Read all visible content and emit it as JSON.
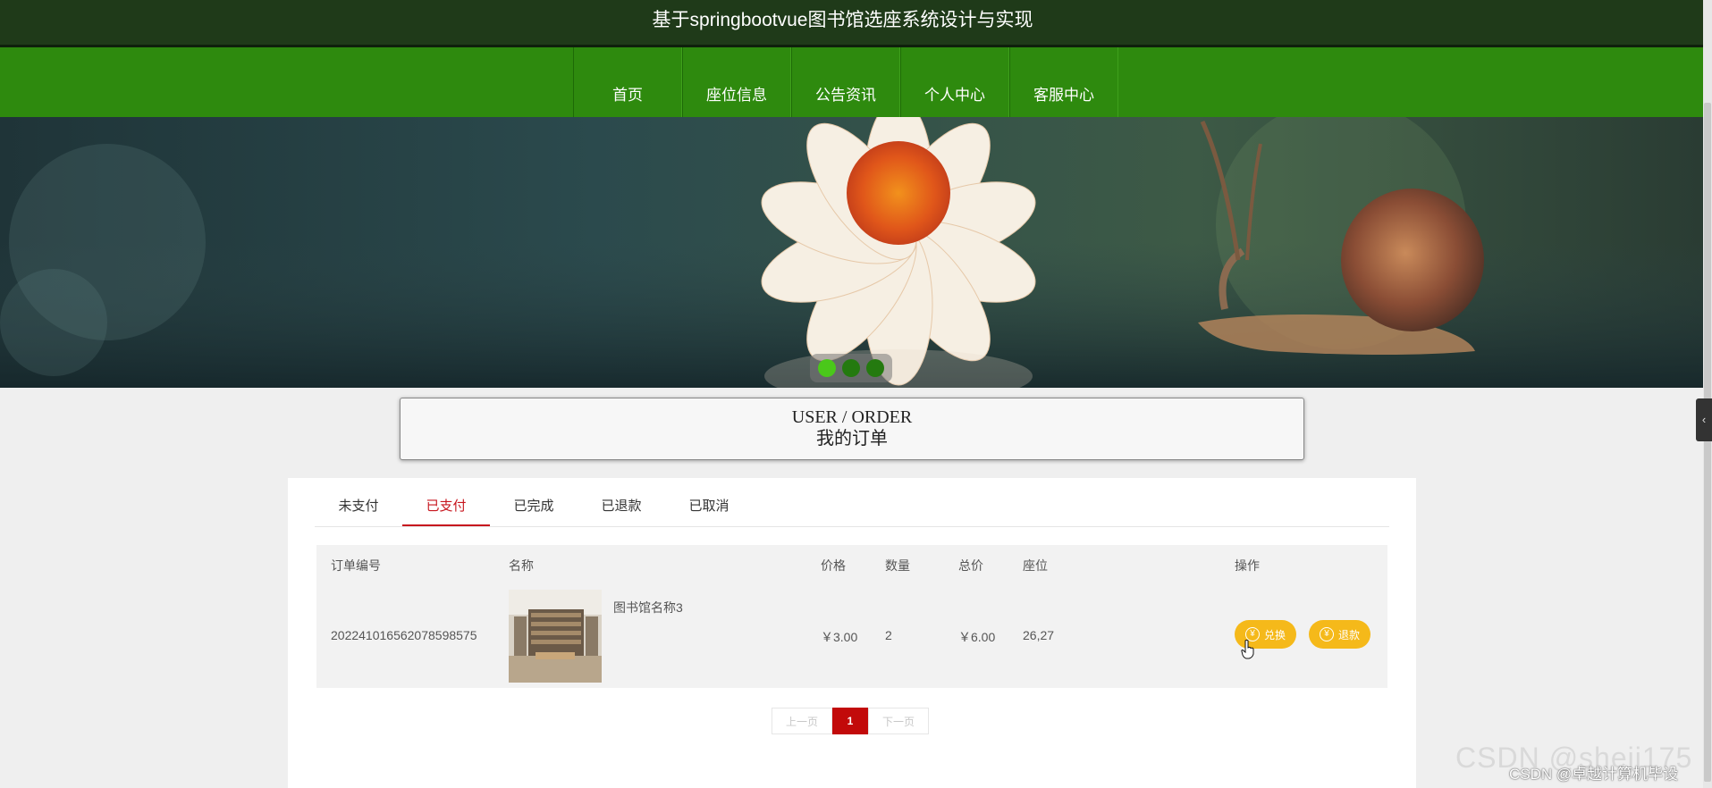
{
  "header": {
    "title": "基于springbootvue图书馆选座系统设计与实现"
  },
  "nav": {
    "items": [
      "首页",
      "座位信息",
      "公告资讯",
      "个人中心",
      "客服中心"
    ]
  },
  "carousel": {
    "slide_count": 3,
    "active_index": 0
  },
  "section": {
    "title_en": "USER / ORDER",
    "title_cn": "我的订单"
  },
  "tabs": {
    "items": [
      "未支付",
      "已支付",
      "已完成",
      "已退款",
      "已取消"
    ],
    "active": "已支付"
  },
  "table": {
    "columns": [
      "订单编号",
      "名称",
      "价格",
      "数量",
      "总价",
      "座位",
      "操作"
    ],
    "rows": [
      {
        "order_no": "20224101656207859857​5",
        "name": "图书馆名称3",
        "price": "￥3.00",
        "quantity": "2",
        "total": "￥6.00",
        "seat": "26,27",
        "actions": [
          "兑换",
          "退款"
        ]
      }
    ]
  },
  "pagination": {
    "prev": "上一页",
    "current": "1",
    "next": "下一页"
  },
  "watermark": {
    "main": "CSDN @sheji175",
    "sub": "CSDN @卓越计算机毕设"
  },
  "colors": {
    "nav_green": "#2e8a0e",
    "title_bar": "#1f3a19",
    "accent_red": "#c7161e",
    "button_yellow": "#f5b91a"
  },
  "icons": {
    "coin": "yen-coin-icon",
    "collapse": "chevron-left-icon"
  }
}
